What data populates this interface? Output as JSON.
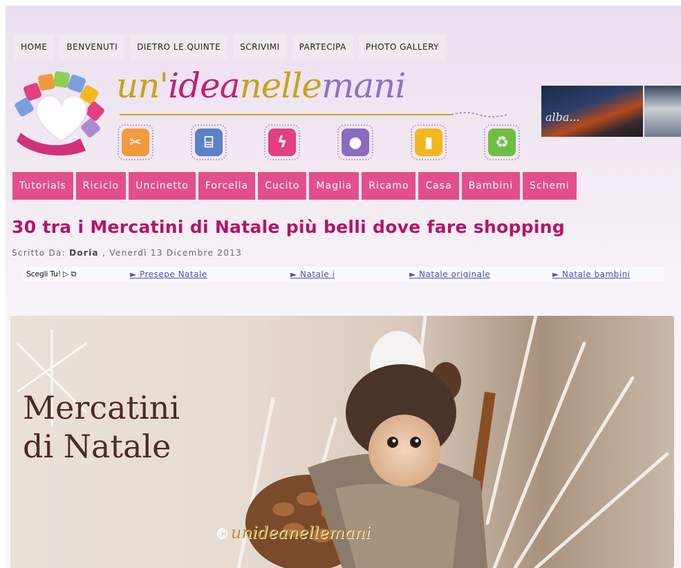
{
  "top_nav": [
    "HOME",
    "BENVENUTI",
    "DIETRO LE QUINTE",
    "SCRIVIMI",
    "PARTECIPA",
    "PHOTO GALLERY"
  ],
  "logo": {
    "part1": "un'",
    "part2": "idea",
    "part3": "nelle",
    "part4": "mani"
  },
  "craft_icons": [
    {
      "icon": "scissors-icon",
      "color": "#f29a3c"
    },
    {
      "icon": "thread-spool-icon",
      "color": "#5a82c6"
    },
    {
      "icon": "needle-thread-icon",
      "color": "#e2407e"
    },
    {
      "icon": "yarn-ball-icon",
      "color": "#8a6cc0"
    },
    {
      "icon": "glue-bottle-icon",
      "color": "#f2b81e"
    },
    {
      "icon": "recycle-icon",
      "color": "#6fbe44"
    }
  ],
  "banner": {
    "text": "alba..."
  },
  "categories": [
    "Tutorials",
    "Riciclo",
    "Uncinetto",
    "Forcella",
    "Cucito",
    "Maglia",
    "Ricamo",
    "Casa",
    "Bambini",
    "Schemi"
  ],
  "post": {
    "title": "30 tra i Mercatini di Natale più belli dove fare shopping",
    "byline_prefix": "Scritto Da:",
    "author": "Doria",
    "date": ", Venerdì 13 Dicembre 2013"
  },
  "ad_row": {
    "choose_label": "Scegli Tu!",
    "links": [
      "► Presepe Natale",
      "► Natale i",
      "► Natale originale",
      "► Natale bambini"
    ]
  },
  "hero": {
    "title_line1": "Mercatini",
    "title_line2": "di Natale",
    "watermark": "unideanellemani",
    "copyright": "©"
  },
  "colors": {
    "accent_pink": "#e34f8a",
    "title_magenta": "#b5136a",
    "link_blue": "#4a4ec0"
  }
}
